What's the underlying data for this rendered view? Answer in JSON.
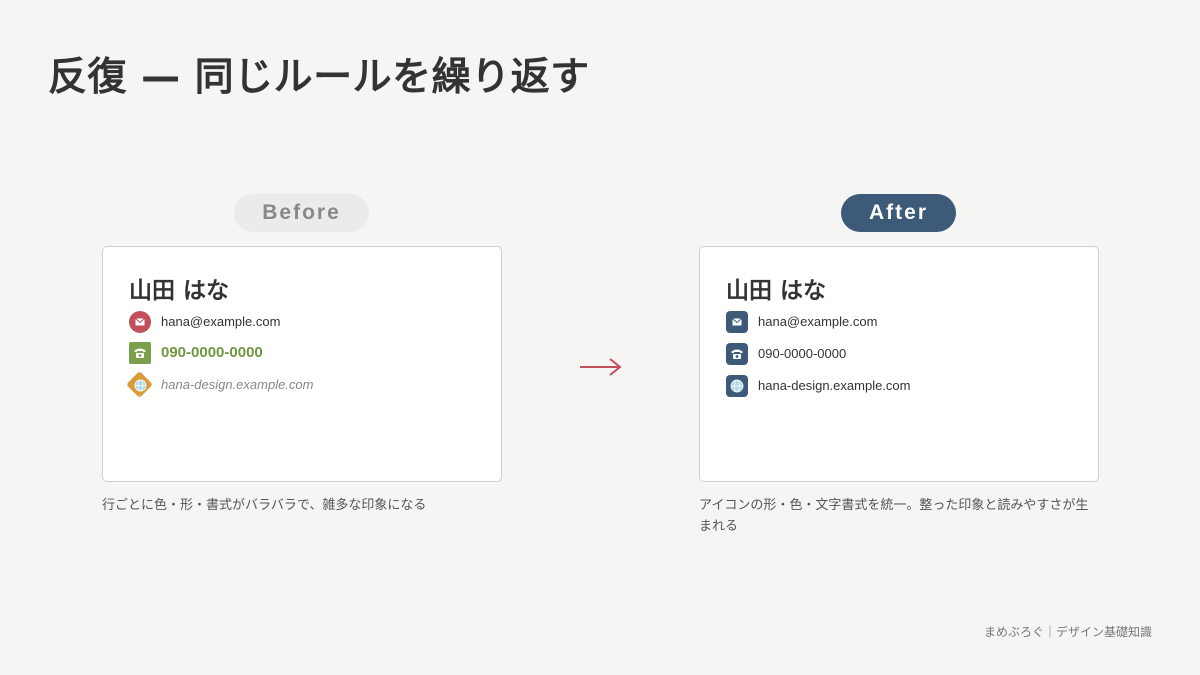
{
  "slide": {
    "title": "反復 — 同じルールを繰り返す",
    "footer": "まめぶろぐ｜デザイン基礎知識"
  },
  "before": {
    "badge": "Before",
    "name": "山田 はな",
    "email": "hana@example.com",
    "phone": "090-0000-0000",
    "web": "hana-design.example.com",
    "caption": "行ごとに色・形・書式がバラバラで、雑多な印象になる",
    "icons": {
      "email": "mail-icon",
      "phone": "phone-icon",
      "web": "globe-icon"
    },
    "colors": {
      "email": "#c0505a",
      "phone": "#7ba04b",
      "web": "#d99c3a"
    }
  },
  "after": {
    "badge": "After",
    "name": "山田 はな",
    "email": "hana@example.com",
    "phone": "090-0000-0000",
    "web": "hana-design.example.com",
    "caption": "アイコンの形・色・文字書式を統一。整った印象と読みやすさが生まれる",
    "icons": {
      "email": "mail-icon",
      "phone": "phone-icon",
      "web": "globe-icon"
    },
    "colors": {
      "icon": "#3d5a78",
      "badge": "#3d5a78"
    }
  },
  "colors": {
    "arrow": "#c0505a",
    "background": "#f5f5f3"
  }
}
